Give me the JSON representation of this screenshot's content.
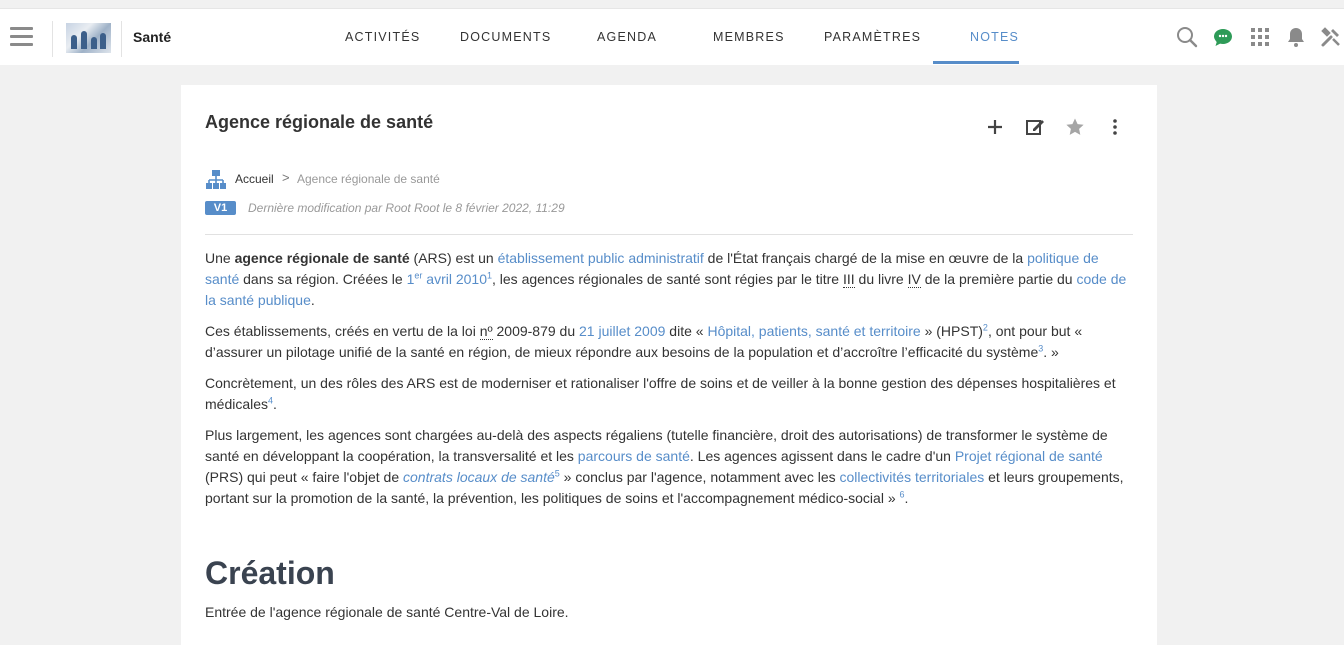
{
  "header": {
    "space_name": "Santé",
    "tabs": [
      "ACTIVITÉS",
      "DOCUMENTS",
      "AGENDA",
      "MEMBRES",
      "PARAMÈTRES",
      "NOTES"
    ],
    "active_tab": "NOTES",
    "icons": [
      "menu-icon",
      "search-icon",
      "chat-icon",
      "apps-grid-icon",
      "bell-icon",
      "tools-icon"
    ],
    "accent": "#578dc9"
  },
  "note": {
    "title": "Agence régionale de santé",
    "actions": [
      "add-icon",
      "edit-icon",
      "star-icon",
      "more-vertical-icon"
    ],
    "breadcrumb": {
      "home": "Accueil",
      "separator": ">",
      "current": "Agence régionale de santé"
    },
    "version": "V1",
    "last_modified": "Dernière modification par Root Root le 8 février 2022, 11:29"
  },
  "body": {
    "p1": {
      "a": "Une ",
      "b_bold": "agence régionale de santé",
      "c": " (ARS) est un ",
      "d_link": "établissement public administratif",
      "e": " de l'État français chargé de la mise en œuvre de la ",
      "f_link": "politique de santé",
      "g": " dans sa région. Créées le ",
      "h_link": "1",
      "h_sup": "er",
      "i_link": " avril 2010",
      "j_sup": "1",
      "k": ", les agences régionales de santé sont régies par le titre ",
      "l_dotted": "III",
      "m": " du livre ",
      "n_dotted": "IV",
      "o": " de la première partie du ",
      "p_link": "code de la santé publique",
      "q": "."
    },
    "p2": {
      "a": "Ces établissements, créés en vertu de la loi ",
      "b_dotted": "nº",
      "c": " 2009-879 du ",
      "d_link": "21 juillet 2009",
      "e": " dite « ",
      "f_link": "Hôpital, patients, santé et territoire",
      "g": " » (HPST)",
      "h_sup": "2",
      "i": ", ont pour but « d’assurer un pilotage unifié de la santé en région, de mieux répondre aux besoins de la population et d’accroître l’efficacité du système",
      "j_sup": "3",
      "k": ". »"
    },
    "p3": {
      "a": "Concrètement, un des rôles des ARS est de moderniser et rationaliser l'offre de soins et de veiller à la bonne gestion des dépenses hospitalières et médicales",
      "b_sup": "4",
      "c": "."
    },
    "p4": {
      "a": "Plus largement, les agences sont chargées au-delà des aspects régaliens (tutelle financière, droit des autorisations) de transformer le système de santé en développant la coopération, la transversalité et les ",
      "b_link": "parcours de santé",
      "c": ". Les agences agissent dans le cadre d'un ",
      "d_link": "Projet régional de santé",
      "e": " (PRS) qui peut « faire l'objet de ",
      "f_link": "contrats locaux de santé",
      "f_sup": "5",
      "g": " » conclus par l'agence, notamment avec les ",
      "h_link": "collectivités territoriales",
      "i": " et leurs groupements, portant sur la promotion de la santé, la prévention, les politiques de soins et l'accompagnement médico-social » ",
      "j_sup": "6",
      "k": "."
    },
    "heading": "Création",
    "last_line": "Entrée de l'agence régionale de santé Centre-Val de Loire."
  }
}
